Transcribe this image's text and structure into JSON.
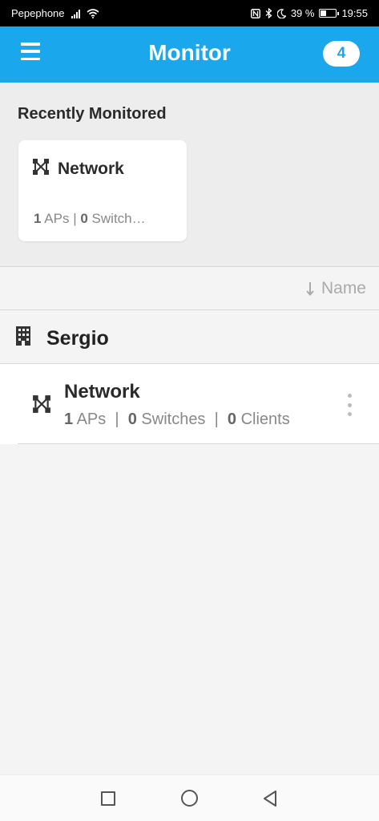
{
  "status_bar": {
    "carrier": "Pepephone",
    "battery": "39 %",
    "time": "19:55",
    "battery_level": 0.39
  },
  "app_bar": {
    "title": "Monitor",
    "badge_count": "4",
    "menu_icon": "hamburger-menu-icon"
  },
  "recent": {
    "title": "Recently Monitored",
    "cards": [
      {
        "name": "Network",
        "aps": "1",
        "aps_label": "APs",
        "separator": "|",
        "switches": "0",
        "switches_label": "Switch…",
        "icon": "network-topology-icon"
      }
    ]
  },
  "sort": {
    "label": "Name",
    "icon": "sort-down-arrow-icon"
  },
  "site": {
    "name": "Sergio",
    "icon": "building-icon"
  },
  "networks": [
    {
      "name": "Network",
      "aps": "1",
      "aps_label": "APs",
      "switches": "0",
      "switches_label": "Switches",
      "clients": "0",
      "clients_label": "Clients",
      "separator": "|",
      "icon": "network-topology-icon"
    }
  ],
  "colors": {
    "accent": "#1aa7ec",
    "status_bar": "#000000"
  }
}
